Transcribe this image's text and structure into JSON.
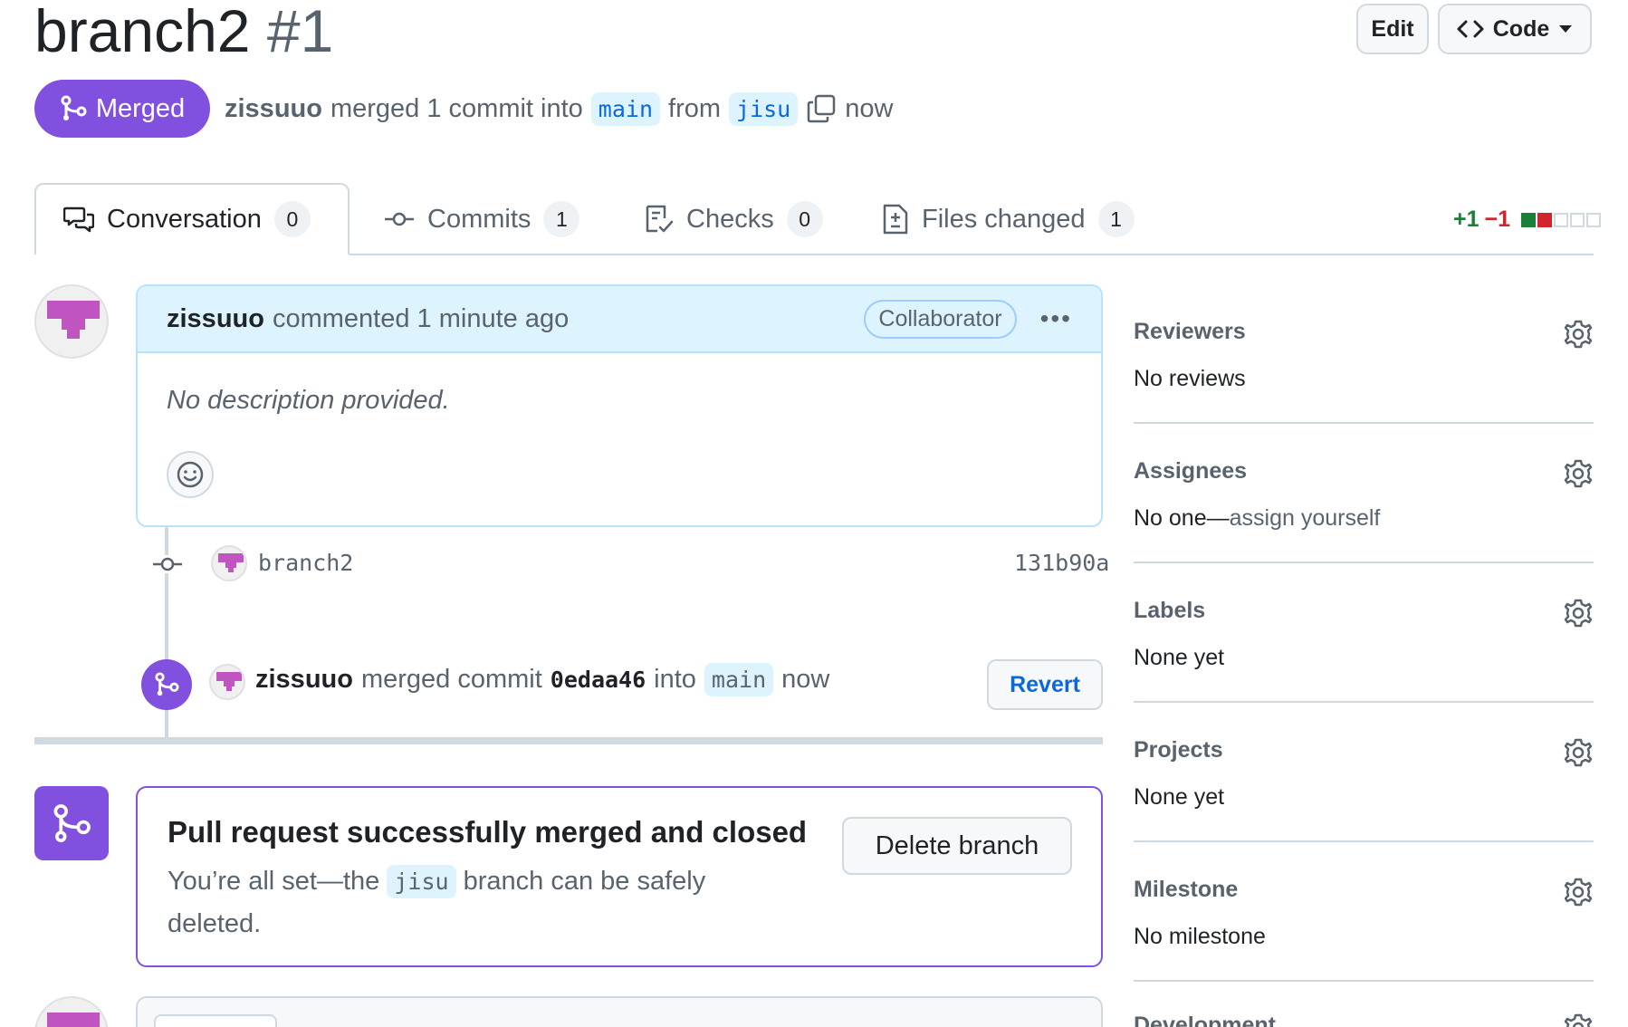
{
  "pr": {
    "title": "branch2",
    "number": "#1"
  },
  "header_buttons": {
    "edit": "Edit",
    "code": "Code"
  },
  "status": {
    "state": "Merged",
    "author": "zissuuo",
    "action": "merged 1 commit into",
    "base": "main",
    "from": "from",
    "head": "jisu",
    "time": "now"
  },
  "tabs": [
    {
      "label": "Conversation",
      "count": "0"
    },
    {
      "label": "Commits",
      "count": "1"
    },
    {
      "label": "Checks",
      "count": "0"
    },
    {
      "label": "Files changed",
      "count": "1"
    }
  ],
  "diffstat": {
    "additions": "+1",
    "deletions": "−1",
    "colors": [
      "#1a7f37",
      "#d1242f",
      "#d1d9e0"
    ]
  },
  "comment": {
    "author": "zissuuo",
    "meta": "commented 1 minute ago",
    "role": "Collaborator",
    "menu": "•••",
    "body": "No description provided."
  },
  "commit": {
    "message": "branch2",
    "sha": "131b90a"
  },
  "merge_event": {
    "author": "zissuuo",
    "text1": "merged commit",
    "sha": "0edaa46",
    "text2": "into",
    "branch": "main",
    "time": "now",
    "revert": "Revert"
  },
  "merged_panel": {
    "title": "Pull request successfully merged and closed",
    "text_before": "You’re all set—the",
    "branch": "jisu",
    "text_after": "branch can be safely deleted.",
    "delete_button": "Delete branch"
  },
  "sidebar": {
    "reviewers": {
      "heading": "Reviewers",
      "value": "No reviews"
    },
    "assignees": {
      "heading": "Assignees",
      "value": "No one—",
      "link": "assign yourself"
    },
    "labels": {
      "heading": "Labels",
      "value": "None yet"
    },
    "projects": {
      "heading": "Projects",
      "value": "None yet"
    },
    "milestone": {
      "heading": "Milestone",
      "value": "No milestone"
    },
    "development": {
      "heading": "Development"
    }
  },
  "colors": {
    "merged": "#8250df",
    "accent": "#0969da",
    "avatar": "#c054c0"
  }
}
